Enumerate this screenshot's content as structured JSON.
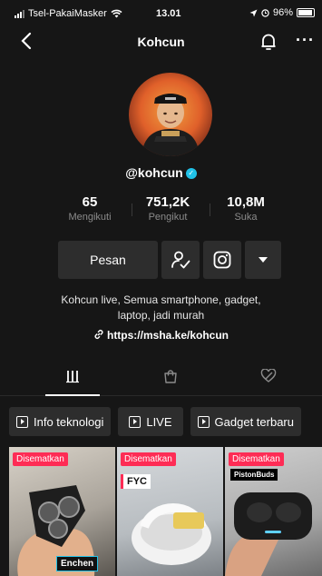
{
  "status_bar": {
    "carrier": "Tsel-PakaiMasker",
    "time": "13.01",
    "battery": "96%"
  },
  "header": {
    "title": "Kohcun",
    "back_icon": "chevron-left-icon",
    "bell_icon": "bell-icon",
    "more_icon": "more-icon",
    "more_label": "···"
  },
  "profile": {
    "username": "@kohcun",
    "verified": true
  },
  "stats": [
    {
      "value": "65",
      "label": "Mengikuti"
    },
    {
      "value": "751,2K",
      "label": "Pengikut"
    },
    {
      "value": "10,8M",
      "label": "Suka"
    }
  ],
  "actions": {
    "message_label": "Pesan"
  },
  "bio": {
    "line1": "Kohcun live, Semua smartphone, gadget,",
    "line2": "laptop, jadi murah",
    "link": "https://msha.ke/kohcun"
  },
  "playlists": [
    {
      "label": "Info teknologi"
    },
    {
      "label": "LIVE"
    },
    {
      "label": "Gadget terbaru"
    }
  ],
  "videos": [
    {
      "pinned_label": "Disematkan",
      "caption": "Enchen"
    },
    {
      "pinned_label": "Disematkan",
      "caption": "FYC"
    },
    {
      "pinned_label": "Disematkan",
      "caption": "PistonBuds"
    }
  ],
  "colors": {
    "background": "#161616",
    "button": "#2d2d2d",
    "accent": "#fe2c55",
    "verified": "#20c2e8"
  }
}
